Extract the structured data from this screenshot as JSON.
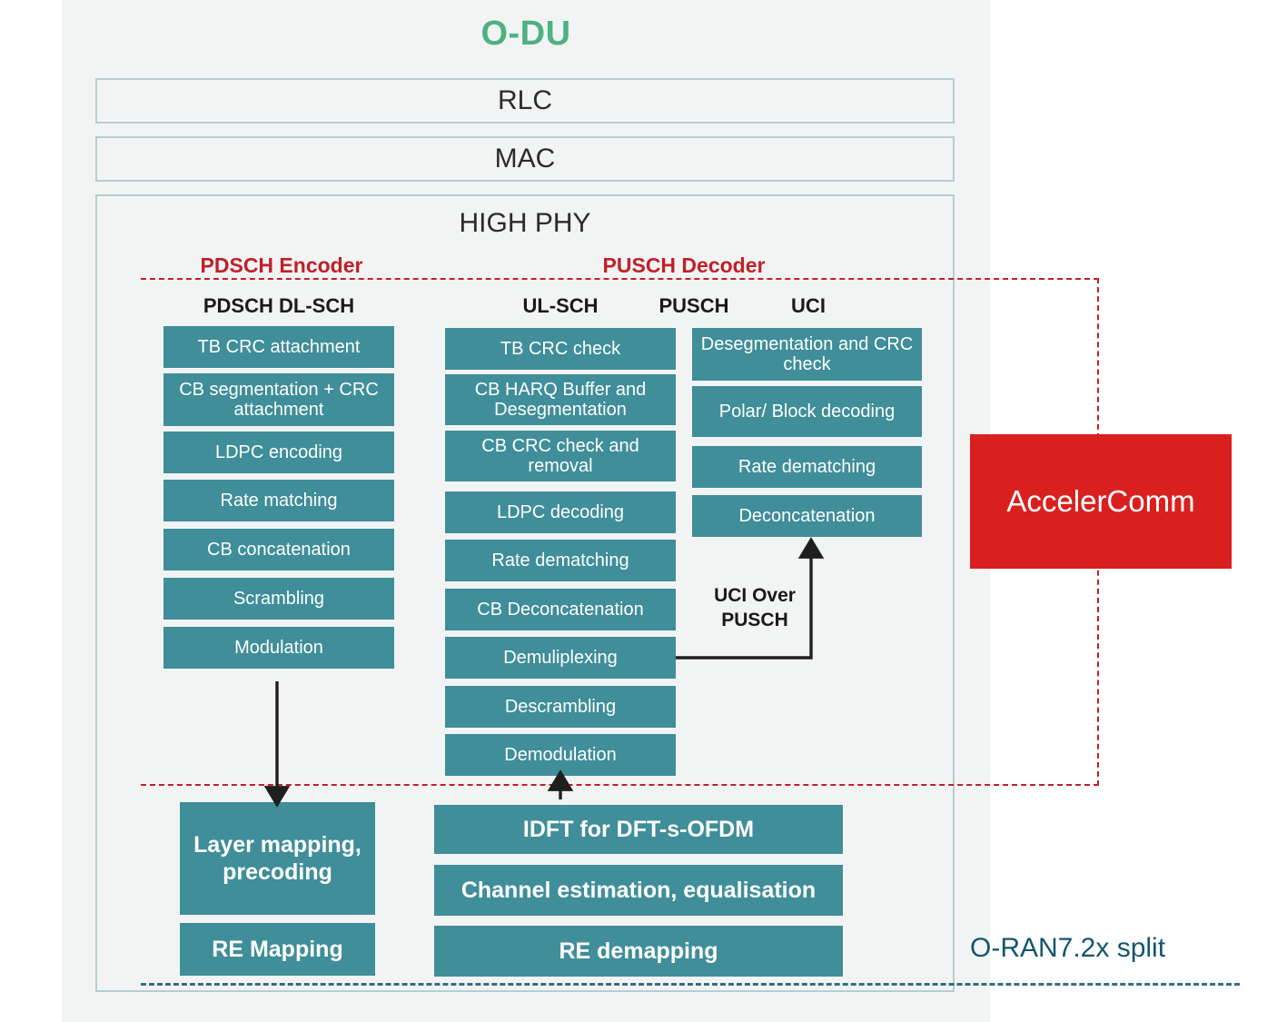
{
  "diagram": {
    "panel_title": "O-DU",
    "accent_colors": {
      "green": "#4fb183",
      "teal_box": "#3f8e99",
      "red": "#c0202a",
      "accelercomm_red": "#d9201f",
      "split_blue": "#14566f",
      "panel_bg": "#f2f4f3",
      "border": "#b3cfd4"
    },
    "layers": [
      {
        "label": "RLC"
      },
      {
        "label": "MAC"
      }
    ],
    "high_phy": {
      "title": "HIGH PHY",
      "sections": [
        {
          "label": "PDSCH Encoder"
        },
        {
          "label": "PUSCH Decoder"
        }
      ],
      "column_headers": [
        {
          "label": "PDSCH DL-SCH"
        },
        {
          "label": "UL-SCH"
        },
        {
          "label": "PUSCH"
        },
        {
          "label": "UCI"
        }
      ],
      "pdsch_dlsch": [
        {
          "label": "TB CRC attachment"
        },
        {
          "label": "CB segmentation + CRC attachment"
        },
        {
          "label": "LDPC  encoding"
        },
        {
          "label": "Rate matching"
        },
        {
          "label": "CB concatenation"
        },
        {
          "label": "Scrambling"
        },
        {
          "label": "Modulation"
        }
      ],
      "ul_sch": [
        {
          "label": "TB CRC check"
        },
        {
          "label": "CB HARQ Buffer and Desegmentation"
        },
        {
          "label": "CB CRC check and removal"
        },
        {
          "label": "LDPC decoding"
        },
        {
          "label": "Rate dematching"
        },
        {
          "label": "CB Deconcatenation"
        },
        {
          "label": "Demuliplexing"
        },
        {
          "label": "Descrambling"
        },
        {
          "label": "Demodulation"
        }
      ],
      "uci": [
        {
          "label": "Desegmentation and CRC check"
        },
        {
          "label": "Polar/ Block decoding"
        },
        {
          "label": "Rate dematching"
        },
        {
          "label": "Deconcatenation"
        }
      ],
      "uci_over_pusch_label": "UCI Over PUSCH"
    },
    "lower_phy": {
      "downlink": [
        {
          "label": "Layer mapping, precoding"
        },
        {
          "label": "RE Mapping"
        }
      ],
      "uplink": [
        {
          "label": "IDFT for DFT-s-OFDM"
        },
        {
          "label": "Channel estimation, equalisation"
        },
        {
          "label": "RE demapping"
        }
      ]
    },
    "vendor_box": {
      "label": "AccelerComm"
    },
    "split_label": {
      "label": "O-RAN7.2x split"
    }
  }
}
